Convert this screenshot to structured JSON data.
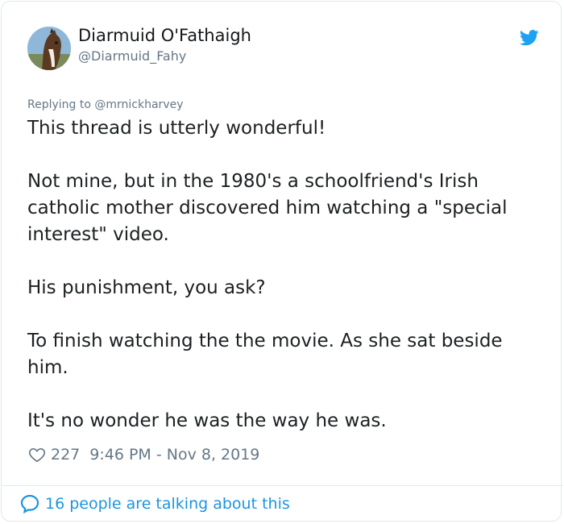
{
  "author": {
    "name": "Diarmuid O'Fathaigh",
    "handle": "@Diarmuid_Fahy",
    "avatar_icon": "horse-photo-avatar"
  },
  "platform_icon": "twitter-bird-icon",
  "colors": {
    "accent": "#1da1f2",
    "link": "#1b95e0",
    "muted": "#657786",
    "text": "#1c2022",
    "border": "#e1e8ed"
  },
  "reply": {
    "prefix": "Replying to",
    "mention": "@mrnickharvey"
  },
  "tweet": {
    "paragraphs": [
      "This thread is utterly wonderful!",
      "Not mine, but in the 1980's a schoolfriend's Irish catholic mother discovered him watching a \"special interest\" video.",
      "His punishment, you ask?",
      "To finish watching the the movie. As she sat beside him.",
      "It's no wonder he was the way he was."
    ]
  },
  "meta": {
    "likes": "227",
    "timestamp": "9:46 PM - Nov 8, 2019"
  },
  "footer": {
    "talking_text": "16 people are talking about this"
  }
}
